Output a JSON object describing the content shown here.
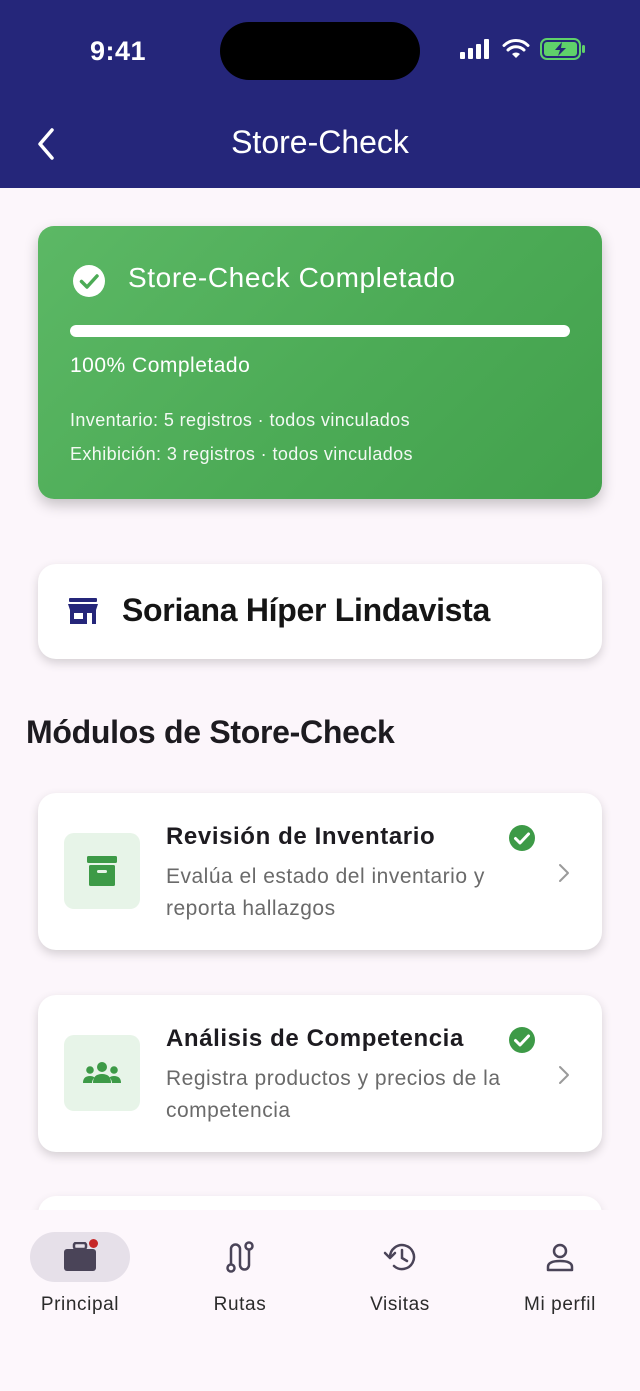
{
  "status_bar": {
    "time": "9:41"
  },
  "header": {
    "title": "Store-Check"
  },
  "completion": {
    "title": "Store-Check Completado",
    "progress": 1.0,
    "progress_text": "100% Completado",
    "inventory_summary": "Inventario: 5 registros · todos vinculados",
    "exhibition_summary": "Exhibición: 3 registros · todos vinculados"
  },
  "store": {
    "name": "Soriana Híper Lindavista",
    "icon": "store-icon"
  },
  "modules_section": {
    "title": "Módulos de Store-Check",
    "items": [
      {
        "title": "Revisión de Inventario",
        "description": "Evalúa el estado del inventario y reporta hallazgos",
        "icon": "archive-icon",
        "completed": true
      },
      {
        "title": "Análisis de Competencia",
        "description": "Registra productos y precios de la competencia",
        "icon": "groups-icon",
        "completed": true
      }
    ]
  },
  "bottom_nav": {
    "items": [
      {
        "label": "Principal",
        "icon": "briefcase-icon",
        "active": true
      },
      {
        "label": "Rutas",
        "icon": "route-icon",
        "active": false
      },
      {
        "label": "Visitas",
        "icon": "history-icon",
        "active": false
      },
      {
        "label": "Mi perfil",
        "icon": "person-icon",
        "active": false
      }
    ]
  },
  "colors": {
    "header": "#25267a",
    "success": "#4cab56",
    "check": "#3d9a47",
    "icon_tint": "#e7f4e8"
  }
}
